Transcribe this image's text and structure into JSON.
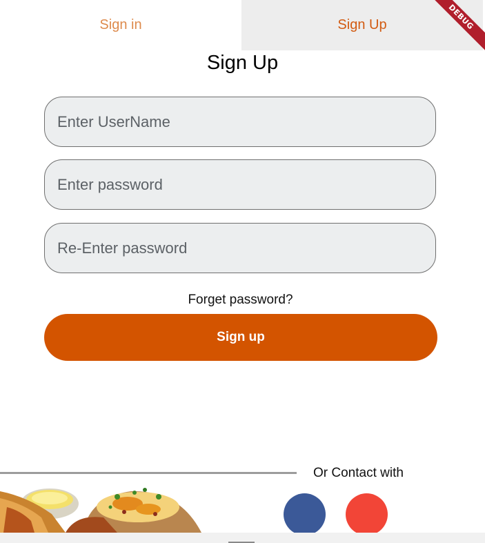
{
  "tabs": {
    "signin": "Sign in",
    "signup": "Sign Up"
  },
  "debug_label": "DEBUG",
  "page": {
    "title": "Sign Up"
  },
  "form": {
    "username_placeholder": "Enter UserName",
    "password_placeholder": "Enter password",
    "reenter_placeholder": "Re-Enter password",
    "forget_label": "Forget password?",
    "submit_label": "Sign up"
  },
  "contact": {
    "label": "Or Contact with",
    "facebook_color": "#3b5998",
    "google_color": "#f24537"
  },
  "colors": {
    "accent": "#d35400",
    "tab_text": "#d5631b",
    "field_bg": "#eceeef"
  }
}
